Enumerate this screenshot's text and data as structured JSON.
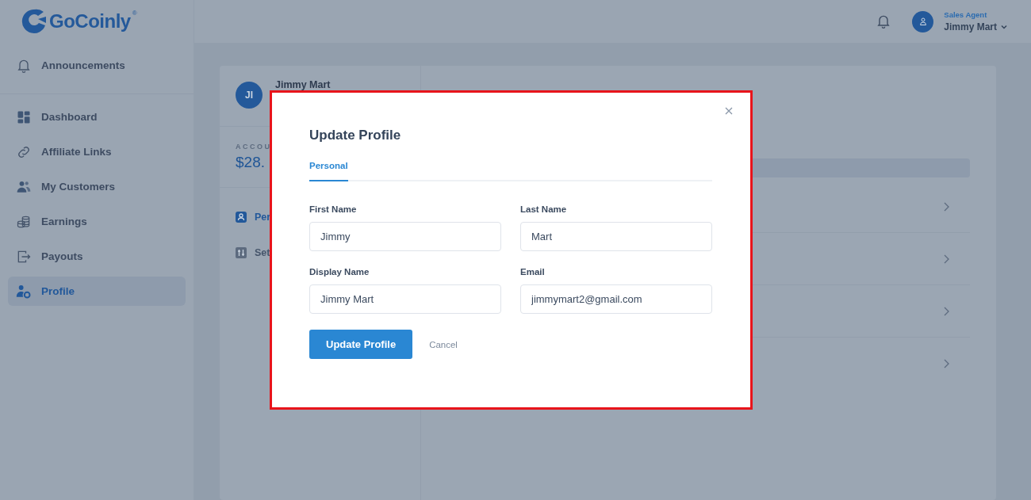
{
  "brand": {
    "name": "GoCoinly",
    "mark": "®"
  },
  "sidebar": {
    "groups": [
      [
        {
          "label": "Announcements",
          "selected": false
        }
      ],
      [
        {
          "label": "Dashboard",
          "selected": false
        },
        {
          "label": "Affiliate Links",
          "selected": false
        },
        {
          "label": "My Customers",
          "selected": false
        },
        {
          "label": "Earnings",
          "selected": false
        },
        {
          "label": "Payouts",
          "selected": false
        },
        {
          "label": "Profile",
          "selected": true
        }
      ]
    ]
  },
  "header": {
    "role": "Sales Agent",
    "user": "Jimmy Mart"
  },
  "profile_card": {
    "initials": "JI",
    "name": "Jimmy Mart",
    "account_label": "ACCOU",
    "balance": "$28.",
    "menu": [
      {
        "label": "Per",
        "selected": true
      },
      {
        "label": "Set",
        "selected": false
      }
    ]
  },
  "modal": {
    "title": "Update Profile",
    "tabs": [
      {
        "label": "Personal",
        "selected": true
      }
    ],
    "fields": [
      {
        "label": "First Name",
        "value": "Jimmy"
      },
      {
        "label": "Last Name",
        "value": "Mart"
      },
      {
        "label": "Display Name",
        "value": "Jimmy Mart"
      },
      {
        "label": "Email",
        "value": "jimmymart2@gmail.com"
      }
    ],
    "submit": "Update Profile",
    "cancel": "Cancel"
  }
}
